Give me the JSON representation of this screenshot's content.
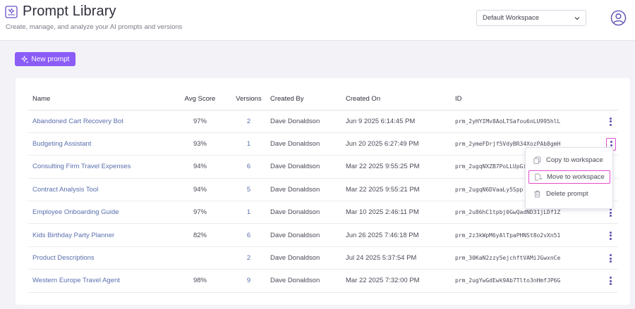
{
  "app": {
    "title": "Prompt Library",
    "subtitle": "Create, manage, and analyze your AI prompts and versions"
  },
  "workspace": {
    "selected": "Default Workspace"
  },
  "actions": {
    "new_prompt_label": "New prompt"
  },
  "table": {
    "headers": {
      "name": "Name",
      "avg_score": "Avg Score",
      "versions": "Versions",
      "created_by": "Created By",
      "created_on": "Created On",
      "id": "ID"
    },
    "rows": [
      {
        "name": "Abandoned Cart Recovery Bot",
        "avg_score": "97%",
        "versions": "2",
        "created_by": "Dave Donaldson",
        "created_on": "Jun 9 2025 6:14:45 PM",
        "id": "prm_2yHYIMv8AoLTSafou6nLU995hlL"
      },
      {
        "name": "Budgeting Assistant",
        "avg_score": "93%",
        "versions": "1",
        "created_by": "Dave Donaldson",
        "created_on": "Jun 20 2025 6:27:49 PM",
        "id": "prm_2ymeFDrjf5VdyBR34XozPAb8gmH"
      },
      {
        "name": "Consulting Firm Travel Expenses",
        "avg_score": "94%",
        "versions": "6",
        "created_by": "Dave Donaldson",
        "created_on": "Mar 22 2025 9:55:25 PM",
        "id": "prm_2ugqNXZB7PoLLUpGi"
      },
      {
        "name": "Contract Analysis Tool",
        "avg_score": "94%",
        "versions": "5",
        "created_by": "Dave Donaldson",
        "created_on": "Mar 22 2025 9:55:21 PM",
        "id": "prm_2ugqN6DVaaLy5Spp"
      },
      {
        "name": "Employee Onboarding Guide",
        "avg_score": "97%",
        "versions": "1",
        "created_by": "Dave Donaldson",
        "created_on": "Mar 10 2025 2:46:11 PM",
        "id": "prm_2u86hC1tpbj0GwQadND31jLDf1Z"
      },
      {
        "name": "Kids Birthday Party Planner",
        "avg_score": "82%",
        "versions": "6",
        "created_by": "Dave Donaldson",
        "created_on": "Jun 26 2025 7:46:18 PM",
        "id": "prm_2z3kWpM6yAlTpaPHNSt8o2vXn51"
      },
      {
        "name": "Product Descriptions",
        "avg_score": "",
        "versions": "2",
        "created_by": "Dave Donaldson",
        "created_on": "Jul 24 2025 5:37:54 PM",
        "id": "prm_30KaN2zzy5ejchftVAMiJGwxnCe"
      },
      {
        "name": "Western Europe Travel Agent",
        "avg_score": "98%",
        "versions": "9",
        "created_by": "Dave Donaldson",
        "created_on": "Mar 22 2025 7:32:00 PM",
        "id": "prm_2ugYwGdEwk9Ab7Tlto3nHmfJP6G"
      }
    ]
  },
  "context_menu": {
    "items": [
      {
        "label": "Copy to workspace",
        "icon": "copy-icon"
      },
      {
        "label": "Move to workspace",
        "icon": "move-file-icon"
      },
      {
        "label": "Delete prompt",
        "icon": "trash-icon"
      }
    ]
  },
  "colors": {
    "accent": "#8b5cf6",
    "link": "#5a6fae",
    "highlight_outline": "#e24ccd"
  }
}
